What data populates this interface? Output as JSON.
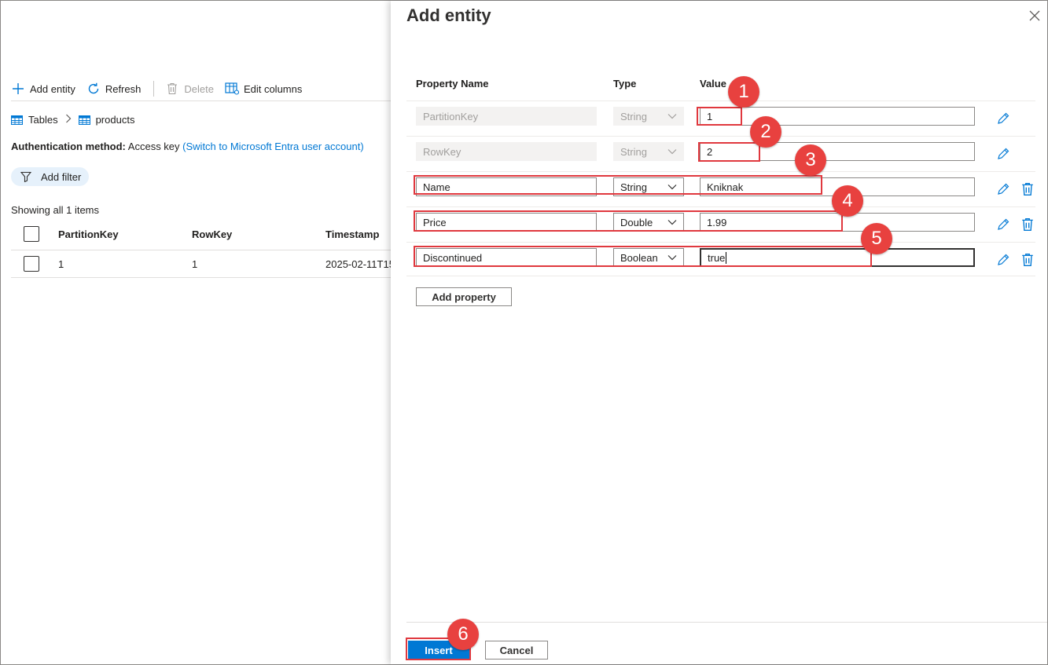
{
  "toolbar": {
    "add_entity": "Add entity",
    "refresh": "Refresh",
    "delete": "Delete",
    "edit_columns": "Edit columns"
  },
  "breadcrumb": {
    "tables": "Tables",
    "products": "products"
  },
  "auth": {
    "label": "Authentication method:",
    "value": "Access key",
    "link": "(Switch to Microsoft Entra user account)"
  },
  "filter": {
    "label": "Add filter"
  },
  "grid": {
    "showing": "Showing all 1 items",
    "columns": [
      "PartitionKey",
      "RowKey",
      "Timestamp"
    ],
    "rows": [
      {
        "partition_key": "1",
        "row_key": "1",
        "timestamp": "2025-02-11T15"
      }
    ]
  },
  "panel": {
    "title": "Add entity",
    "headers": {
      "name": "Property Name",
      "type": "Type",
      "value": "Value"
    },
    "properties": [
      {
        "name": "PartitionKey",
        "type": "String",
        "value": "1",
        "disabled": true
      },
      {
        "name": "RowKey",
        "type": "String",
        "value": "2",
        "disabled": true
      },
      {
        "name": "Name",
        "type": "String",
        "value": "Kniknak",
        "disabled": false
      },
      {
        "name": "Price",
        "type": "Double",
        "value": "1.99",
        "disabled": false
      },
      {
        "name": "Discontinued",
        "type": "Boolean",
        "value": "true",
        "disabled": false
      }
    ],
    "add_property": "Add property",
    "insert": "Insert",
    "cancel": "Cancel"
  },
  "markers": [
    "1",
    "2",
    "3",
    "4",
    "5",
    "6"
  ],
  "colors": {
    "accent": "#0078d4",
    "highlight": "#e0383e",
    "marker": "#e8413f"
  }
}
